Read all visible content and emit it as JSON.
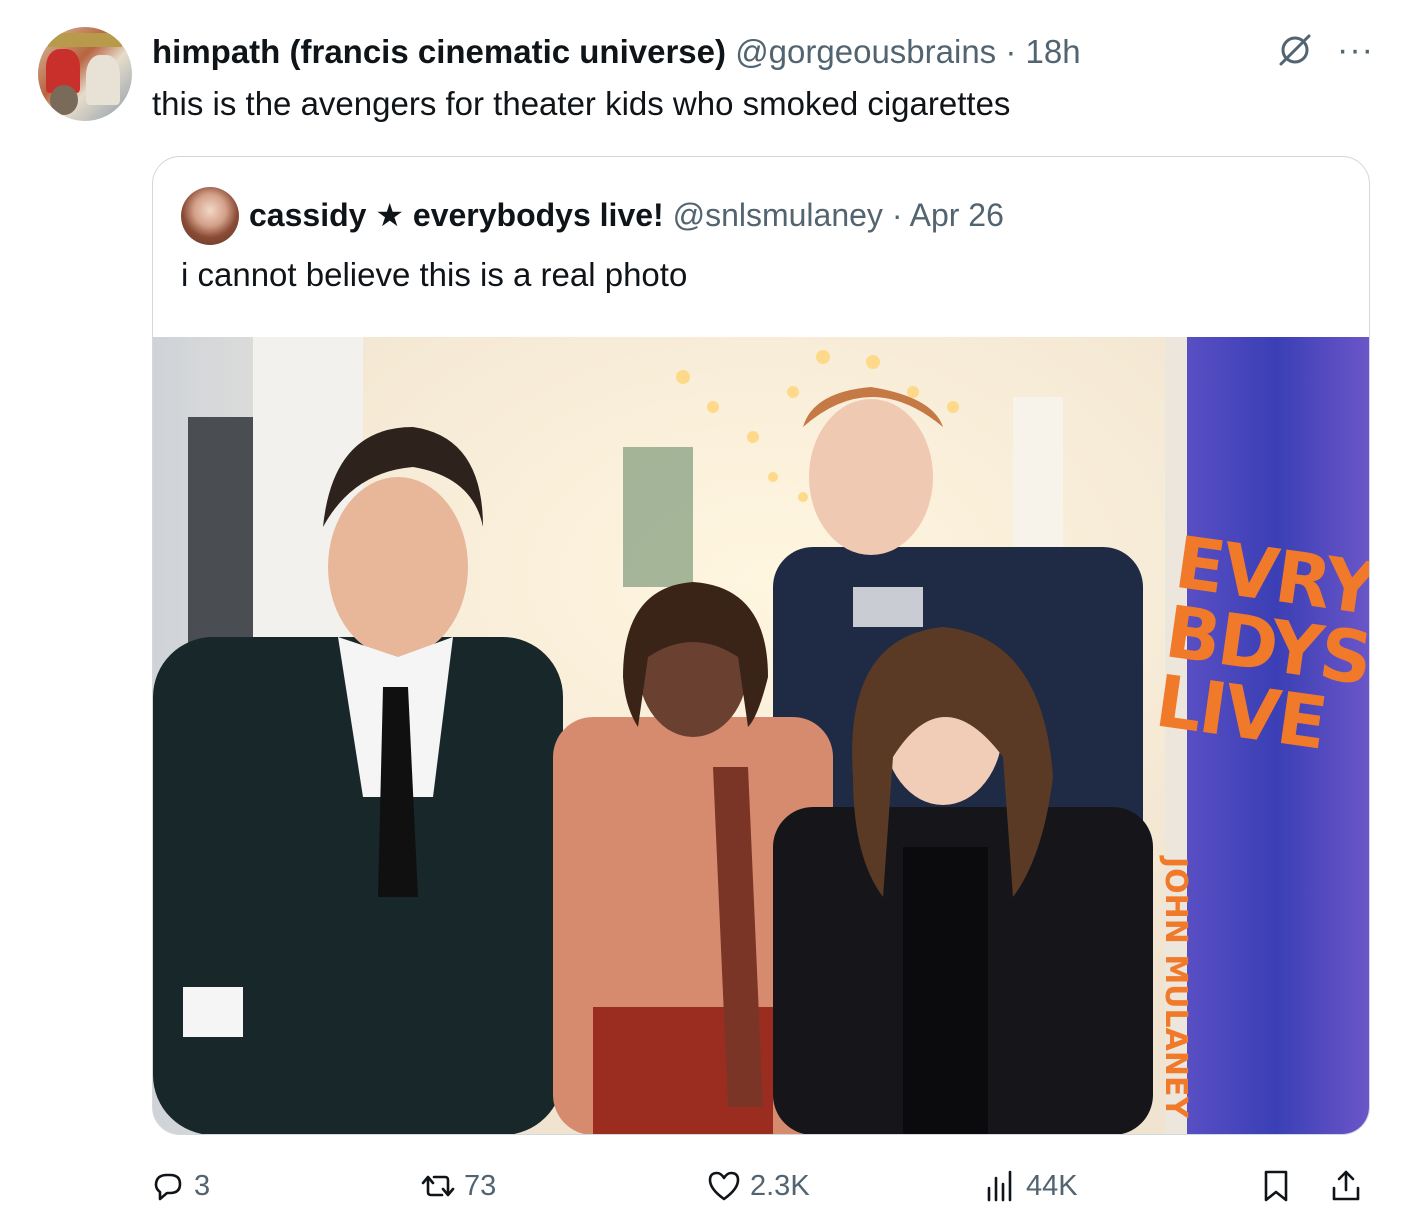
{
  "post": {
    "author_name": "himpath (francis cinematic universe)",
    "author_handle": "@gorgeousbrains",
    "separator": "·",
    "time": "18h",
    "text": "this is the avengers for theater kids who smoked cigarettes"
  },
  "quoted": {
    "author_name": "cassidy ★ everybodys live!",
    "author_handle": "@snlsmulaney",
    "separator": "·",
    "date": "Apr 26",
    "text": "i cannot believe this is a real photo",
    "photo": {
      "banner_text": [
        "EVRY",
        "BDYS",
        "LIVE"
      ],
      "banner_subtext": "JOHN MULANEY"
    }
  },
  "actions": {
    "replies": "3",
    "reposts": "73",
    "likes": "2.3K",
    "views": "44K"
  },
  "icons": {
    "reply": "reply-icon",
    "repost": "repost-icon",
    "like": "like-icon",
    "views": "views-icon",
    "bookmark": "bookmark-icon",
    "share": "share-icon",
    "grok": "grok-icon",
    "more": "more-icon"
  },
  "colors": {
    "text_primary": "#0f1419",
    "text_secondary": "#536471",
    "border": "#cfd9de",
    "banner_orange": "#f07a2a",
    "banner_purple": "#3b3fb5"
  }
}
